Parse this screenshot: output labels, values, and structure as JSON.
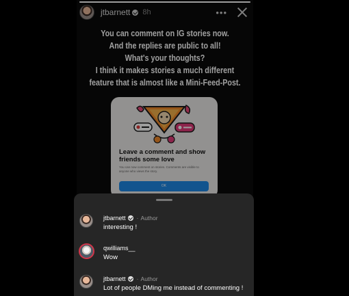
{
  "story": {
    "progress": 1.0,
    "header": {
      "username": "jtbarnett",
      "time": "8h",
      "more_glyph": "•••",
      "close_glyph": "close-icon"
    },
    "caption_lines": [
      "You can comment on IG stories now.",
      "And the replies are public to all!",
      "What's your thoughts?",
      "I think it makes stories a much different",
      "feature that is almost like a Mini-Feed-Post."
    ],
    "card": {
      "title": "Leave a comment and show friends some love",
      "body": "You can now comment on stories. Comments are visible to anyone who views the story.",
      "button": "OK"
    }
  },
  "comments": [
    {
      "username": "jtbarnett",
      "verified": true,
      "role": "Author",
      "text": "interesting !"
    },
    {
      "username": "qwilliams__",
      "verified": false,
      "role": "",
      "text": "Wow"
    },
    {
      "username": "jtbarnett",
      "verified": true,
      "role": "Author",
      "text": "Lot of people DMing me instead of commenting !"
    }
  ],
  "colors": {
    "background": "#000000",
    "sheet": "#262626",
    "card_button": "#1e88e5",
    "ring": "#d2364a"
  }
}
